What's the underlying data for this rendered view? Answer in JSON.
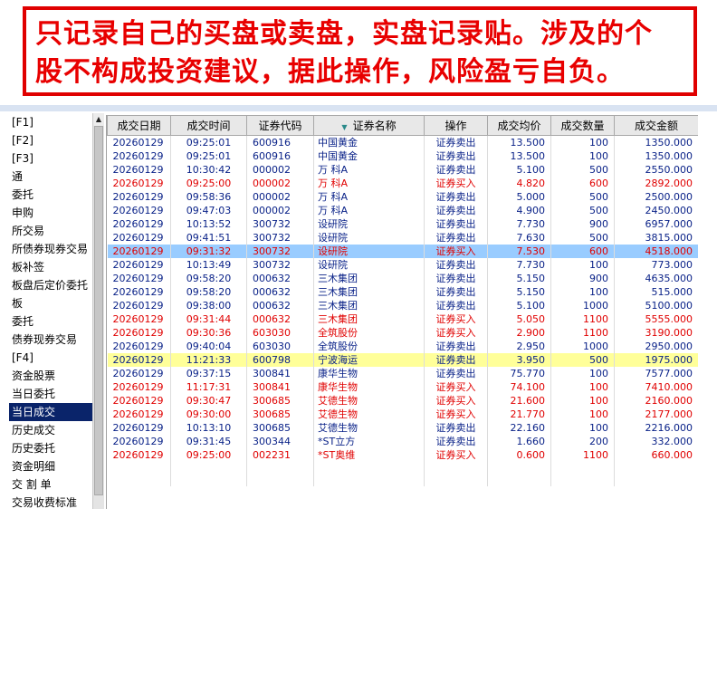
{
  "banner": {
    "line1": "只记录自己的买盘或卖盘，实盘记录贴。涉及的个",
    "line2": "股不构成投资建议，据此操作，风险盈亏自负。"
  },
  "sidebar": {
    "items": [
      {
        "label": "[F1]",
        "selected": false
      },
      {
        "label": "[F2]",
        "selected": false
      },
      {
        "label": "[F3]",
        "selected": false
      },
      {
        "label": "通",
        "selected": false
      },
      {
        "label": "委托",
        "selected": false
      },
      {
        "label": "申购",
        "selected": false
      },
      {
        "label": "所交易",
        "selected": false
      },
      {
        "label": "所债券现券交易",
        "selected": false
      },
      {
        "label": "板补签",
        "selected": false
      },
      {
        "label": "板盘后定价委托",
        "selected": false
      },
      {
        "label": "板",
        "selected": false
      },
      {
        "label": "委托",
        "selected": false
      },
      {
        "label": "债券现券交易",
        "selected": false
      },
      {
        "label": "[F4]",
        "selected": false
      },
      {
        "label": "资金股票",
        "selected": false
      },
      {
        "label": "当日委托",
        "selected": false
      },
      {
        "label": "当日成交",
        "selected": true
      },
      {
        "label": "历史成交",
        "selected": false
      },
      {
        "label": "历史委托",
        "selected": false
      },
      {
        "label": "资金明细",
        "selected": false
      },
      {
        "label": "交 割 单",
        "selected": false
      },
      {
        "label": "交易收费标准",
        "selected": false
      }
    ]
  },
  "table": {
    "columns": [
      "成交日期",
      "成交时间",
      "证券代码",
      "证券名称",
      "操作",
      "成交均价",
      "成交数量",
      "成交金额"
    ],
    "colors": {
      "sell": "#0a2288",
      "buy": "#e00000",
      "highlight_blue": "#99ccff",
      "highlight_yellow": "#ffff99"
    },
    "rows": [
      {
        "date": "20260129",
        "time": "09:25:01",
        "code": "600916",
        "name": "中国黄金",
        "action": "证券卖出",
        "price": "13.500",
        "qty": "100",
        "amount": "1350.000",
        "side": "sell",
        "highlight": ""
      },
      {
        "date": "20260129",
        "time": "09:25:01",
        "code": "600916",
        "name": "中国黄金",
        "action": "证券卖出",
        "price": "13.500",
        "qty": "100",
        "amount": "1350.000",
        "side": "sell",
        "highlight": ""
      },
      {
        "date": "20260129",
        "time": "10:30:42",
        "code": "000002",
        "name": "万 科A",
        "action": "证券卖出",
        "price": "5.100",
        "qty": "500",
        "amount": "2550.000",
        "side": "sell",
        "highlight": ""
      },
      {
        "date": "20260129",
        "time": "09:25:00",
        "code": "000002",
        "name": "万 科A",
        "action": "证券买入",
        "price": "4.820",
        "qty": "600",
        "amount": "2892.000",
        "side": "buy",
        "highlight": ""
      },
      {
        "date": "20260129",
        "time": "09:58:36",
        "code": "000002",
        "name": "万 科A",
        "action": "证券卖出",
        "price": "5.000",
        "qty": "500",
        "amount": "2500.000",
        "side": "sell",
        "highlight": ""
      },
      {
        "date": "20260129",
        "time": "09:47:03",
        "code": "000002",
        "name": "万 科A",
        "action": "证券卖出",
        "price": "4.900",
        "qty": "500",
        "amount": "2450.000",
        "side": "sell",
        "highlight": ""
      },
      {
        "date": "20260129",
        "time": "10:13:52",
        "code": "300732",
        "name": "设研院",
        "action": "证券卖出",
        "price": "7.730",
        "qty": "900",
        "amount": "6957.000",
        "side": "sell",
        "highlight": ""
      },
      {
        "date": "20260129",
        "time": "09:41:51",
        "code": "300732",
        "name": "设研院",
        "action": "证券卖出",
        "price": "7.630",
        "qty": "500",
        "amount": "3815.000",
        "side": "sell",
        "highlight": ""
      },
      {
        "date": "20260129",
        "time": "09:31:32",
        "code": "300732",
        "name": "设研院",
        "action": "证券买入",
        "price": "7.530",
        "qty": "600",
        "amount": "4518.000",
        "side": "buy",
        "highlight": "blue"
      },
      {
        "date": "20260129",
        "time": "10:13:49",
        "code": "300732",
        "name": "设研院",
        "action": "证券卖出",
        "price": "7.730",
        "qty": "100",
        "amount": "773.000",
        "side": "sell",
        "highlight": ""
      },
      {
        "date": "20260129",
        "time": "09:58:20",
        "code": "000632",
        "name": "三木集团",
        "action": "证券卖出",
        "price": "5.150",
        "qty": "900",
        "amount": "4635.000",
        "side": "sell",
        "highlight": ""
      },
      {
        "date": "20260129",
        "time": "09:58:20",
        "code": "000632",
        "name": "三木集团",
        "action": "证券卖出",
        "price": "5.150",
        "qty": "100",
        "amount": "515.000",
        "side": "sell",
        "highlight": ""
      },
      {
        "date": "20260129",
        "time": "09:38:00",
        "code": "000632",
        "name": "三木集团",
        "action": "证券卖出",
        "price": "5.100",
        "qty": "1000",
        "amount": "5100.000",
        "side": "sell",
        "highlight": ""
      },
      {
        "date": "20260129",
        "time": "09:31:44",
        "code": "000632",
        "name": "三木集团",
        "action": "证券买入",
        "price": "5.050",
        "qty": "1100",
        "amount": "5555.000",
        "side": "buy",
        "highlight": ""
      },
      {
        "date": "20260129",
        "time": "09:30:36",
        "code": "603030",
        "name": "全筑股份",
        "action": "证券买入",
        "price": "2.900",
        "qty": "1100",
        "amount": "3190.000",
        "side": "buy",
        "highlight": ""
      },
      {
        "date": "20260129",
        "time": "09:40:04",
        "code": "603030",
        "name": "全筑股份",
        "action": "证券卖出",
        "price": "2.950",
        "qty": "1000",
        "amount": "2950.000",
        "side": "sell",
        "highlight": ""
      },
      {
        "date": "20260129",
        "time": "11:21:33",
        "code": "600798",
        "name": "宁波海运",
        "action": "证券卖出",
        "price": "3.950",
        "qty": "500",
        "amount": "1975.000",
        "side": "sell",
        "highlight": "yellow"
      },
      {
        "date": "20260129",
        "time": "09:37:15",
        "code": "300841",
        "name": "康华生物",
        "action": "证券卖出",
        "price": "75.770",
        "qty": "100",
        "amount": "7577.000",
        "side": "sell",
        "highlight": ""
      },
      {
        "date": "20260129",
        "time": "11:17:31",
        "code": "300841",
        "name": "康华生物",
        "action": "证券买入",
        "price": "74.100",
        "qty": "100",
        "amount": "7410.000",
        "side": "buy",
        "highlight": ""
      },
      {
        "date": "20260129",
        "time": "09:30:47",
        "code": "300685",
        "name": "艾德生物",
        "action": "证券买入",
        "price": "21.600",
        "qty": "100",
        "amount": "2160.000",
        "side": "buy",
        "highlight": ""
      },
      {
        "date": "20260129",
        "time": "09:30:00",
        "code": "300685",
        "name": "艾德生物",
        "action": "证券买入",
        "price": "21.770",
        "qty": "100",
        "amount": "2177.000",
        "side": "buy",
        "highlight": ""
      },
      {
        "date": "20260129",
        "time": "10:13:10",
        "code": "300685",
        "name": "艾德生物",
        "action": "证券卖出",
        "price": "22.160",
        "qty": "100",
        "amount": "2216.000",
        "side": "sell",
        "highlight": ""
      },
      {
        "date": "20260129",
        "time": "09:31:45",
        "code": "300344",
        "name": "*ST立方",
        "action": "证券卖出",
        "price": "1.660",
        "qty": "200",
        "amount": "332.000",
        "side": "sell",
        "highlight": ""
      },
      {
        "date": "20260129",
        "time": "09:25:00",
        "code": "002231",
        "name": "*ST奥维",
        "action": "证券买入",
        "price": "0.600",
        "qty": "1100",
        "amount": "660.000",
        "side": "buy",
        "highlight": ""
      }
    ]
  }
}
